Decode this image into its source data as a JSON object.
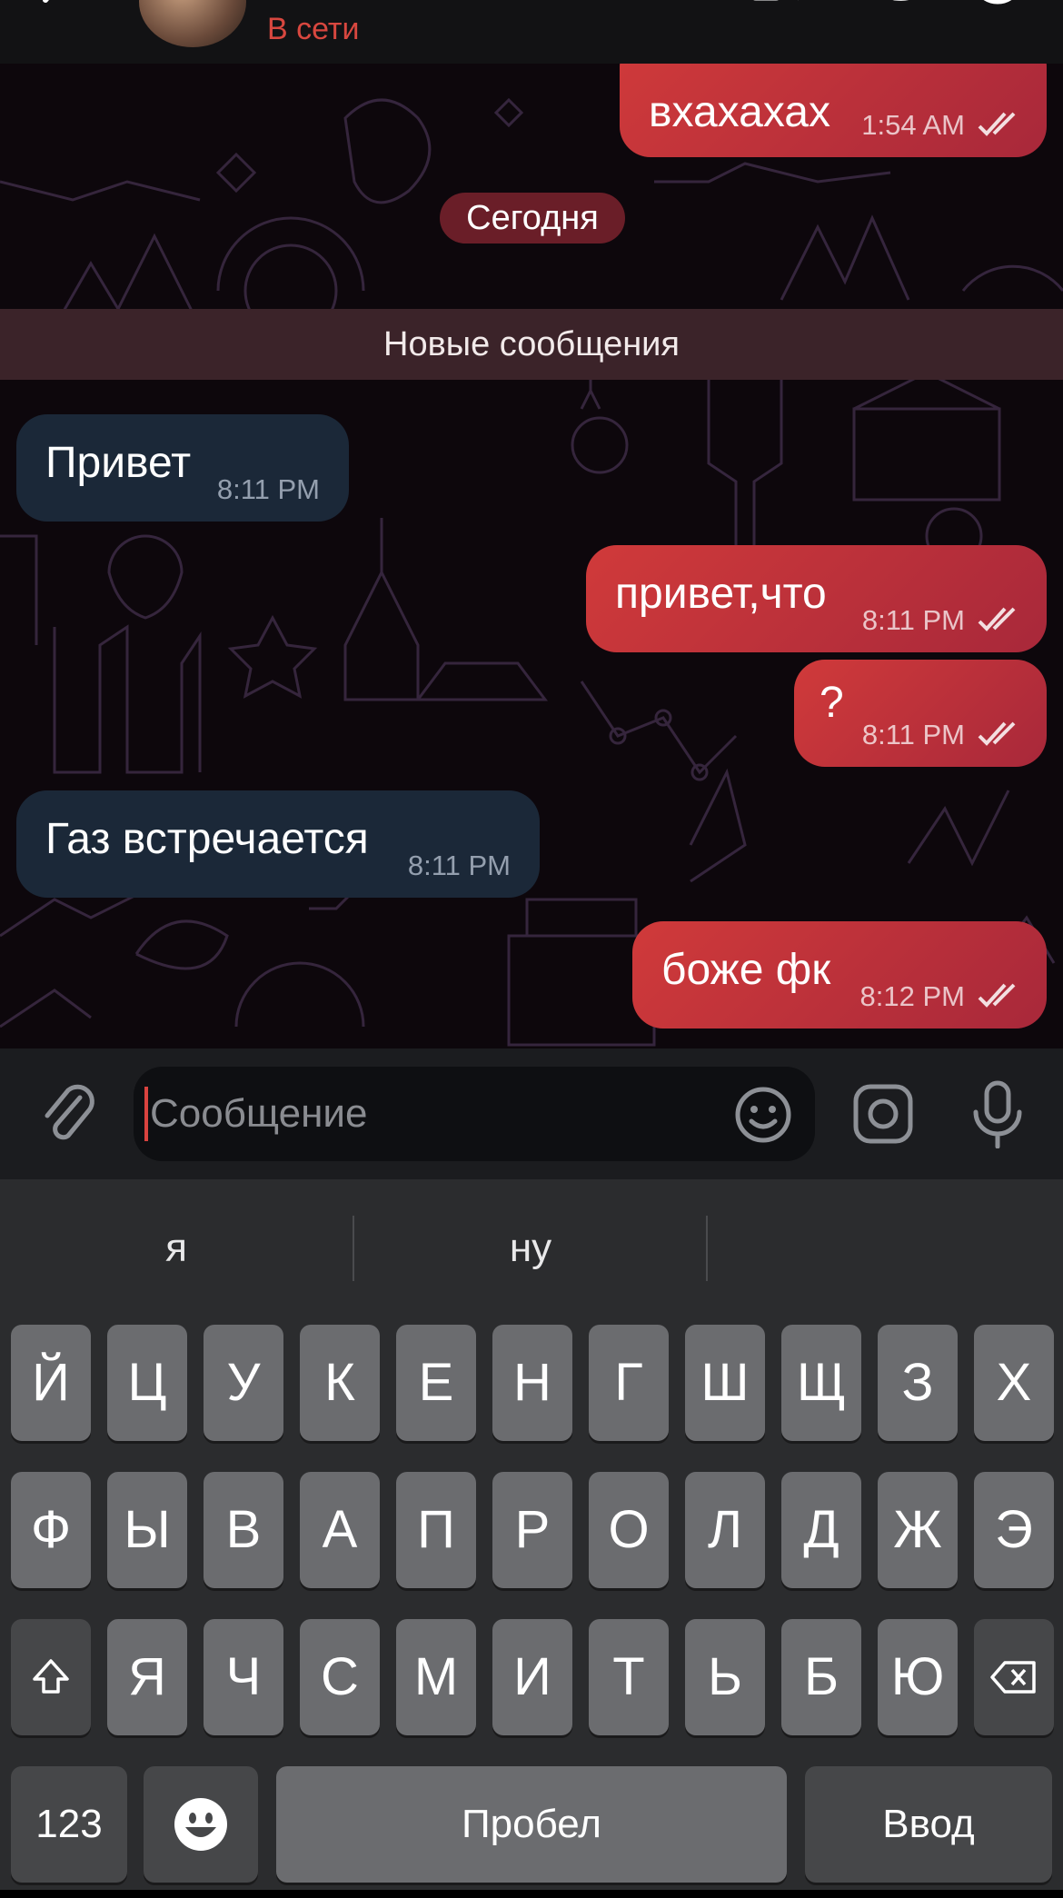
{
  "header": {
    "status": "В сети"
  },
  "chat": {
    "date_separator": "Сегодня",
    "new_messages_label": "Новые сообщения",
    "messages": [
      {
        "text": "вхахахах",
        "time": "1:54 AM",
        "direction": "out",
        "read": true
      },
      {
        "text": "Привет",
        "time": "8:11 PM",
        "direction": "in"
      },
      {
        "text": "привет,что",
        "time": "8:11 PM",
        "direction": "out",
        "read": true
      },
      {
        "text": "?",
        "time": "8:11 PM",
        "direction": "out",
        "read": true
      },
      {
        "text": "Газ встречается",
        "time": "8:11 PM",
        "direction": "in"
      },
      {
        "text": "боже фк",
        "time": "8:12 PM",
        "direction": "out",
        "read": true
      }
    ]
  },
  "composer": {
    "placeholder": "Сообщение"
  },
  "keyboard": {
    "suggestions": [
      "я",
      "ну"
    ],
    "row1": [
      "Й",
      "Ц",
      "У",
      "К",
      "Е",
      "Н",
      "Г",
      "Ш",
      "Щ",
      "З",
      "Х"
    ],
    "row2": [
      "Ф",
      "Ы",
      "В",
      "А",
      "П",
      "Р",
      "О",
      "Л",
      "Д",
      "Ж",
      "Э"
    ],
    "row3": [
      "Я",
      "Ч",
      "С",
      "М",
      "И",
      "Т",
      "Ь",
      "Б",
      "Ю"
    ],
    "numbers_label": "123",
    "space_label": "Пробел",
    "enter_label": "Ввод"
  },
  "colors": {
    "accent": "#d8473f",
    "outgoing_bubble": "#c8363a",
    "incoming_bubble": "#1b2838",
    "chat_bg": "#0d070c"
  },
  "icons": [
    "back-arrow-icon",
    "video-call-icon",
    "phone-icon",
    "more-icon",
    "read-receipt-icon",
    "attach-icon",
    "emoji-icon",
    "camera-icon",
    "mic-icon",
    "shift-icon",
    "backspace-icon",
    "emoji-keyboard-icon"
  ]
}
